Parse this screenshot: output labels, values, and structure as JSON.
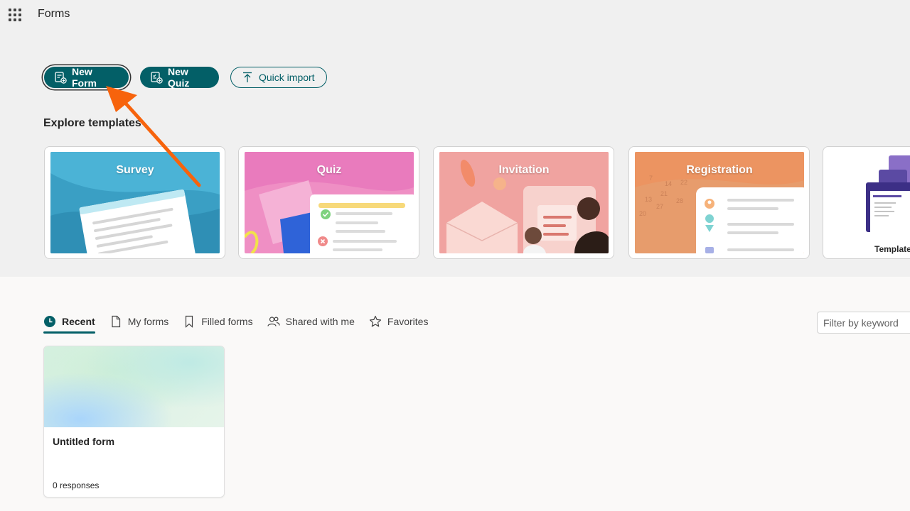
{
  "header": {
    "app_title": "Forms"
  },
  "actions": {
    "new_form": "New Form",
    "new_quiz": "New Quiz",
    "quick_import": "Quick import"
  },
  "templates": {
    "title": "Explore templates",
    "items": [
      {
        "label": "Survey"
      },
      {
        "label": "Quiz"
      },
      {
        "label": "Invitation"
      },
      {
        "label": "Registration"
      },
      {
        "label": "Template"
      }
    ]
  },
  "tabs": [
    {
      "label": "Recent",
      "icon": "clock-icon",
      "active": true
    },
    {
      "label": "My forms",
      "icon": "document-icon"
    },
    {
      "label": "Filled forms",
      "icon": "bookmark-icon"
    },
    {
      "label": "Shared with me",
      "icon": "people-icon"
    },
    {
      "label": "Favorites",
      "icon": "star-icon"
    }
  ],
  "filter": {
    "placeholder": "Filter by keyword"
  },
  "forms": [
    {
      "name": "Untitled form",
      "responses": "0 responses"
    }
  ],
  "colors": {
    "accent": "#035f67",
    "annotation": "#f7630c"
  }
}
